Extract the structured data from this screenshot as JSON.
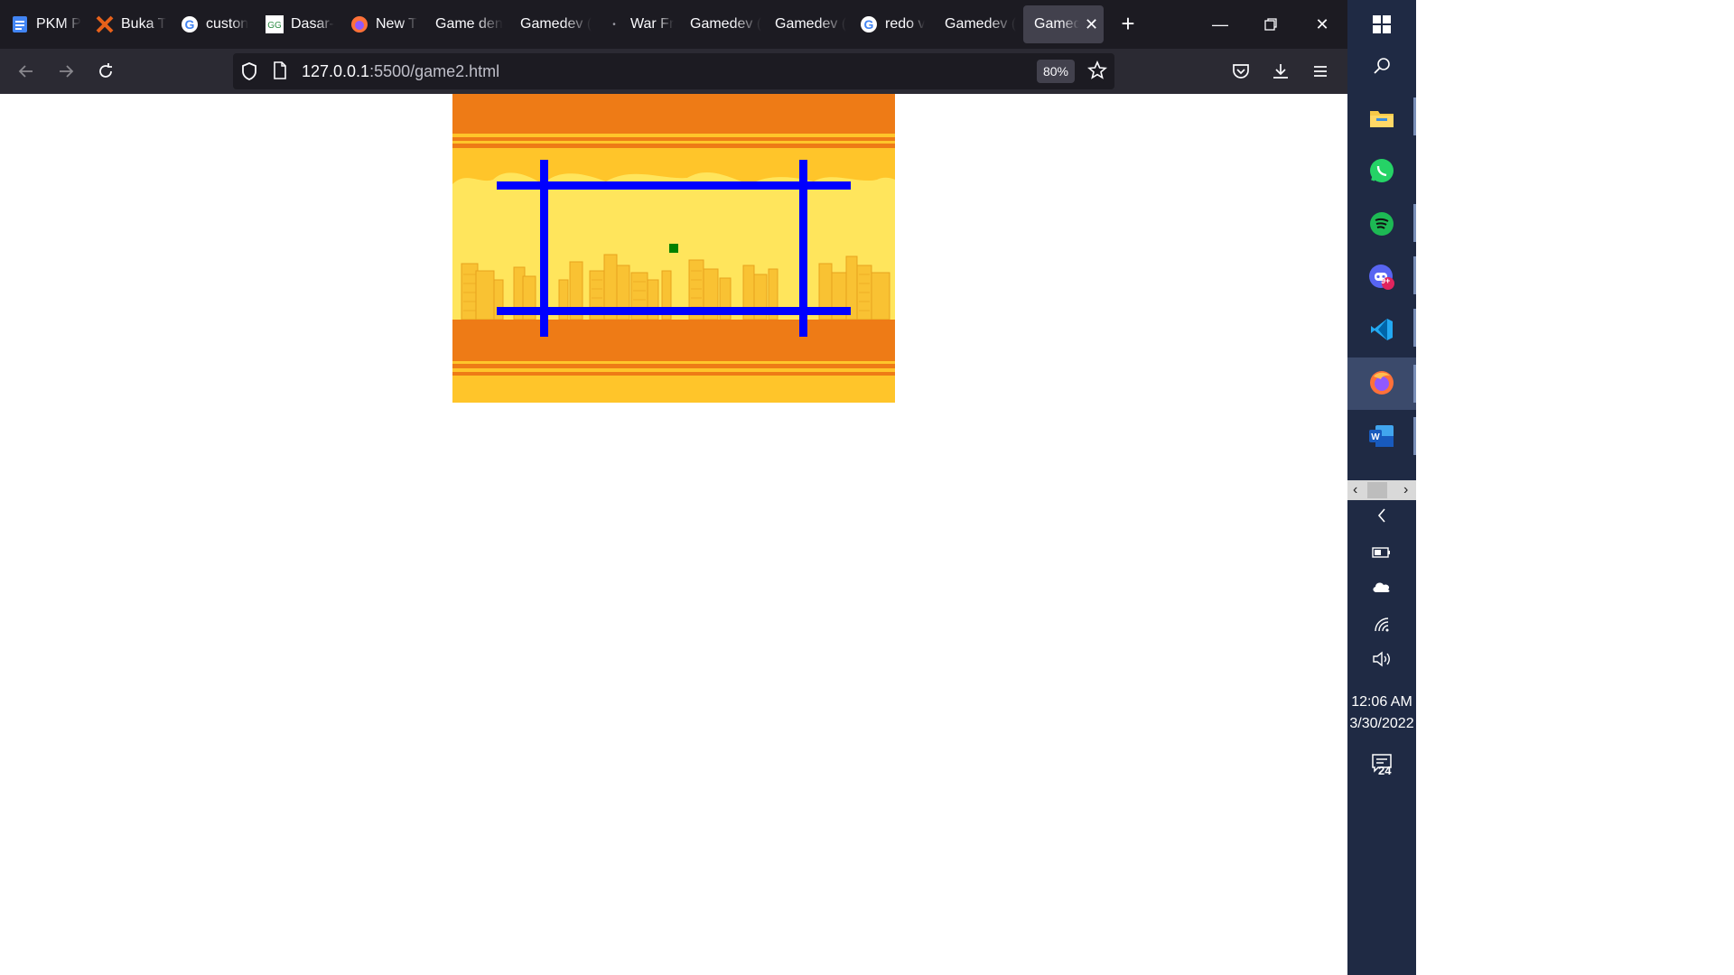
{
  "browser": {
    "tabs": [
      {
        "label": "PKM P",
        "icon": "docs-icon",
        "active": false
      },
      {
        "label": "Buka T",
        "icon": "x-logo-icon",
        "active": false
      },
      {
        "label": "custon",
        "icon": "google-icon",
        "active": false
      },
      {
        "label": "Dasar-",
        "icon": "geeksforgeeks-icon",
        "active": false
      },
      {
        "label": "New T",
        "icon": "firefox-icon",
        "active": false
      },
      {
        "label": "Game den",
        "icon": "none",
        "active": false
      },
      {
        "label": "Gamedev (",
        "icon": "none",
        "active": false
      },
      {
        "label": "War Fr",
        "icon": "loading-icon",
        "active": false
      },
      {
        "label": "Gamedev (",
        "icon": "none",
        "active": false
      },
      {
        "label": "Gamedev (",
        "icon": "none",
        "active": false
      },
      {
        "label": "redo v",
        "icon": "google-icon",
        "active": false
      },
      {
        "label": "Gamedev (",
        "icon": "none",
        "active": false
      },
      {
        "label": "Gamedev",
        "icon": "none",
        "active": true
      }
    ],
    "url_host": "127.0.0.1",
    "url_path": ":5500/game2.html",
    "zoom": "80%"
  },
  "taskbar": {
    "apps": [
      "file-explorer-icon",
      "whatsapp-icon",
      "spotify-icon",
      "discord-icon",
      "vscode-icon",
      "firefox-icon",
      "word-icon"
    ],
    "discord_badge": "9+",
    "time": "12:06 AM",
    "date": "3/30/2022",
    "notifications": "24"
  },
  "game": {
    "colors": {
      "sky_orange": "#ee7b16",
      "sky_yellow": "#ffc52a",
      "cloud": "#ffe55c",
      "buildings": "#f9c233",
      "building_line": "#e8a21e",
      "ground_orange": "#ee7b16",
      "frame_blue": "#0000ff",
      "player_green": "#008000"
    }
  }
}
